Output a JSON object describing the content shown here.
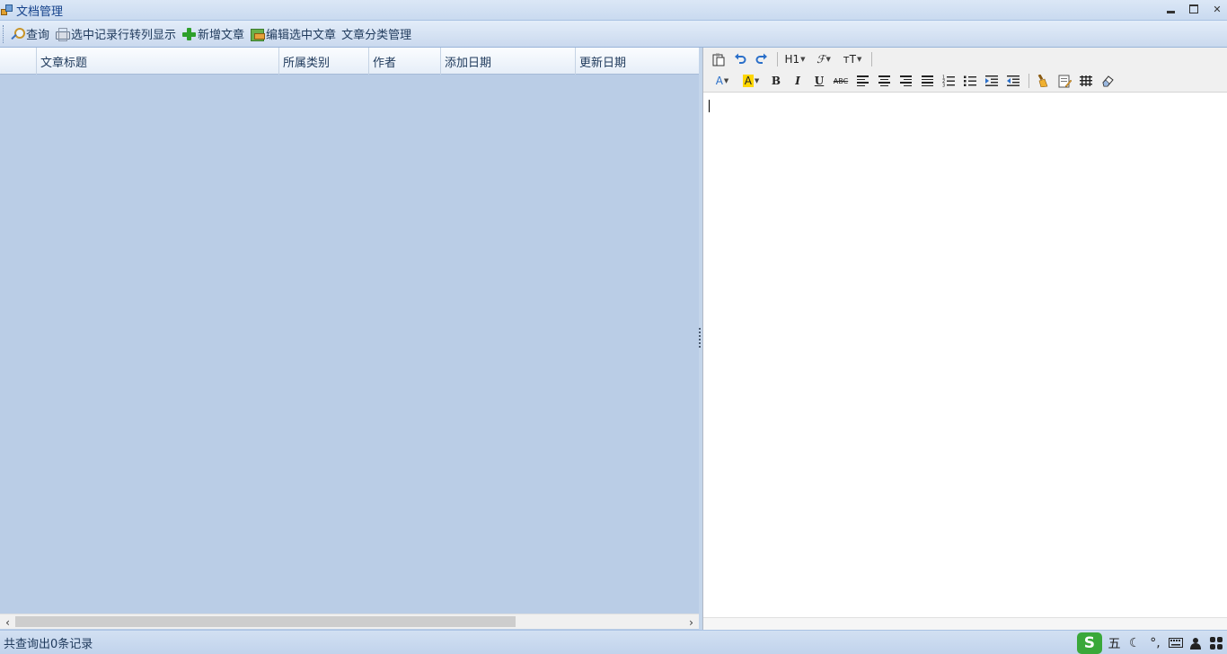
{
  "window": {
    "title": "文档管理"
  },
  "toolbar": {
    "query_label": "查询",
    "transpose_label": "选中记录行转列显示",
    "new_article_label": "新增文章",
    "edit_selected_label": "编辑选中文章",
    "category_manage_label": "文章分类管理"
  },
  "grid": {
    "columns": [
      "",
      "文章标题",
      "所属类别",
      "作者",
      "添加日期",
      "更新日期"
    ],
    "rows": []
  },
  "editor": {
    "toolbar_row1": [
      "paste-icon",
      "undo-icon",
      "redo-icon",
      "H1",
      "font-family",
      "font-size"
    ],
    "heading_label": "H1",
    "font_label": "ℱ",
    "size_label": "ᴛT",
    "toolbar_row2": [
      "font-color",
      "highlight-color",
      "bold",
      "italic",
      "underline",
      "strikethrough",
      "align-left",
      "align-center",
      "align-right",
      "justify",
      "ordered-list",
      "unordered-list",
      "indent",
      "outdent",
      "format-brush",
      "html-source",
      "table",
      "eraser"
    ],
    "font_color_label": "A",
    "highlight_label": "A",
    "bold_label": "B",
    "italic_label": "I",
    "underline_label": "U",
    "strike_label": "ABC",
    "content": ""
  },
  "status": {
    "text": "共查询出0条记录"
  },
  "ime": {
    "logo": "S",
    "mode": "五"
  },
  "colors": {
    "grid_bg": "#bacde6",
    "accent": "#15428b",
    "ime_green": "#3aa83a"
  }
}
